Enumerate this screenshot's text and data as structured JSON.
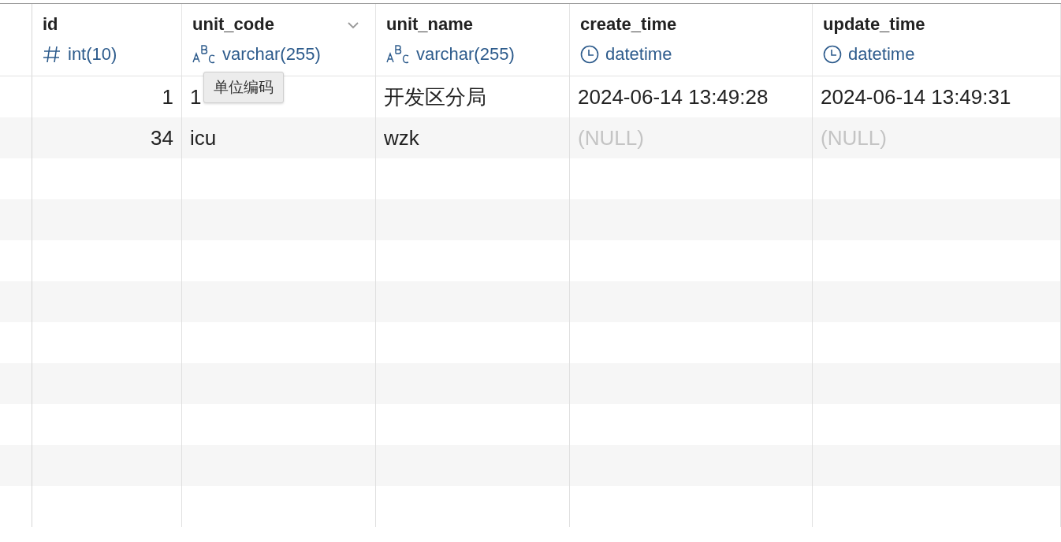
{
  "table": {
    "columns": [
      {
        "name": "id",
        "type": "int(10)",
        "kind": "number",
        "menu": false
      },
      {
        "name": "unit_code",
        "type": "varchar(255)",
        "kind": "text",
        "menu": true
      },
      {
        "name": "unit_name",
        "type": "varchar(255)",
        "kind": "text",
        "menu": false
      },
      {
        "name": "create_time",
        "type": "datetime",
        "kind": "datetime",
        "menu": false
      },
      {
        "name": "update_time",
        "type": "datetime",
        "kind": "datetime",
        "menu": false
      }
    ],
    "rows": [
      [
        {
          "text": "1",
          "null": false
        },
        {
          "text": "1",
          "null": false
        },
        {
          "text": "开发区分局",
          "null": false
        },
        {
          "text": "2024-06-14 13:49:28",
          "null": false
        },
        {
          "text": "2024-06-14 13:49:31",
          "null": false
        }
      ],
      [
        {
          "text": "34",
          "null": false
        },
        {
          "text": "icu",
          "null": false
        },
        {
          "text": "wzk",
          "null": false
        },
        {
          "text": "(NULL)",
          "null": true
        },
        {
          "text": "(NULL)",
          "null": true
        }
      ]
    ]
  },
  "tooltip": {
    "text": "单位编码"
  }
}
